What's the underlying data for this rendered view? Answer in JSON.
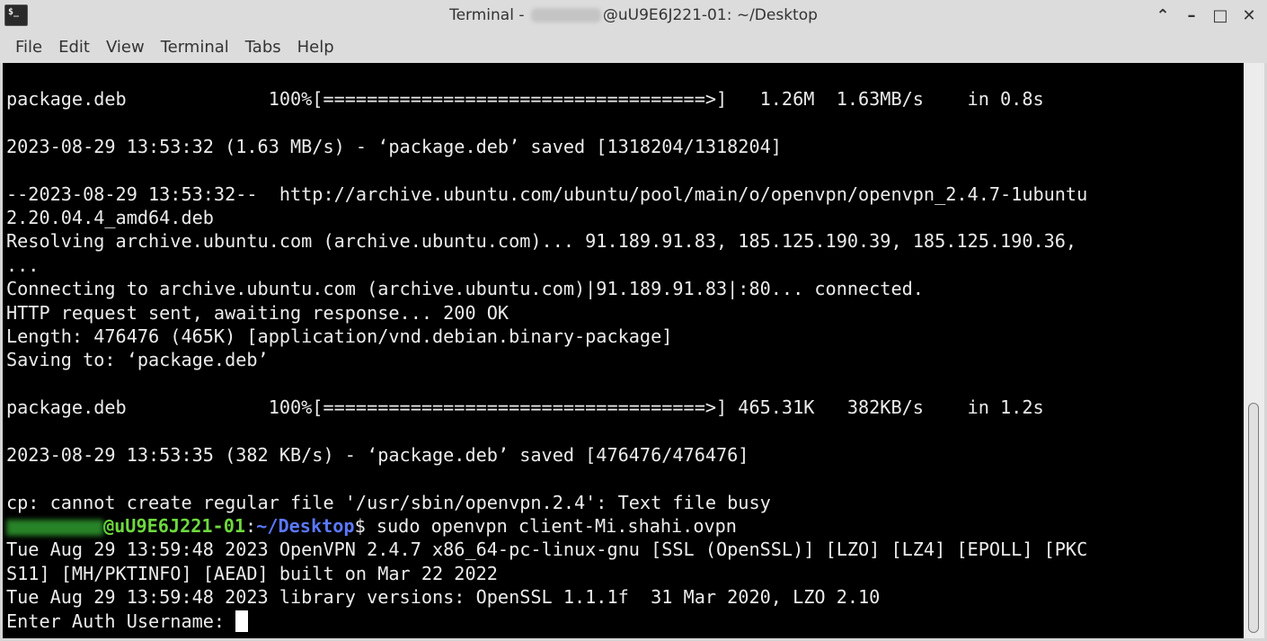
{
  "window": {
    "title_prefix": "Terminal - ",
    "title_suffix": "@uU9E6J221-01: ~/Desktop",
    "icon_glyph": "$_"
  },
  "menubar": {
    "items": [
      "File",
      "Edit",
      "View",
      "Terminal",
      "Tabs",
      "Help"
    ]
  },
  "terminal": {
    "lines": [
      "package.deb             100%[===================================>]   1.26M  1.63MB/s    in 0.8s",
      "",
      "2023-08-29 13:53:32 (1.63 MB/s) - ‘package.deb’ saved [1318204/1318204]",
      "",
      "--2023-08-29 13:53:32--  http://archive.ubuntu.com/ubuntu/pool/main/o/openvpn/openvpn_2.4.7-1ubuntu",
      "2.20.04.4_amd64.deb",
      "Resolving archive.ubuntu.com (archive.ubuntu.com)... 91.189.91.83, 185.125.190.39, 185.125.190.36,",
      "...",
      "Connecting to archive.ubuntu.com (archive.ubuntu.com)|91.189.91.83|:80... connected.",
      "HTTP request sent, awaiting response... 200 OK",
      "Length: 476476 (465K) [application/vnd.debian.binary-package]",
      "Saving to: ‘package.deb’",
      "",
      "package.deb             100%[===================================>] 465.31K   382KB/s    in 1.2s",
      "",
      "2023-08-29 13:53:35 (382 KB/s) - ‘package.deb’ saved [476476/476476]",
      "",
      "cp: cannot create regular file '/usr/sbin/openvpn.2.4': Text file busy"
    ],
    "prompt": {
      "host": "@uU9E6J221-01",
      "colon": ":",
      "path": "~/Desktop",
      "dollar": "$ ",
      "command": "sudo openvpn client-Mi.shahi.ovpn"
    },
    "after_lines": [
      "Tue Aug 29 13:59:48 2023 OpenVPN 2.4.7 x86_64-pc-linux-gnu [SSL (OpenSSL)] [LZO] [LZ4] [EPOLL] [PKC",
      "S11] [MH/PKTINFO] [AEAD] built on Mar 22 2022",
      "Tue Aug 29 13:59:48 2023 library versions: OpenSSL 1.1.1f  31 Mar 2020, LZO 2.10"
    ],
    "input_prompt": "Enter Auth Username: "
  },
  "colors": {
    "terminal_bg": "#000000",
    "prompt_user": "#6ed83e",
    "prompt_path": "#5b78ff"
  }
}
